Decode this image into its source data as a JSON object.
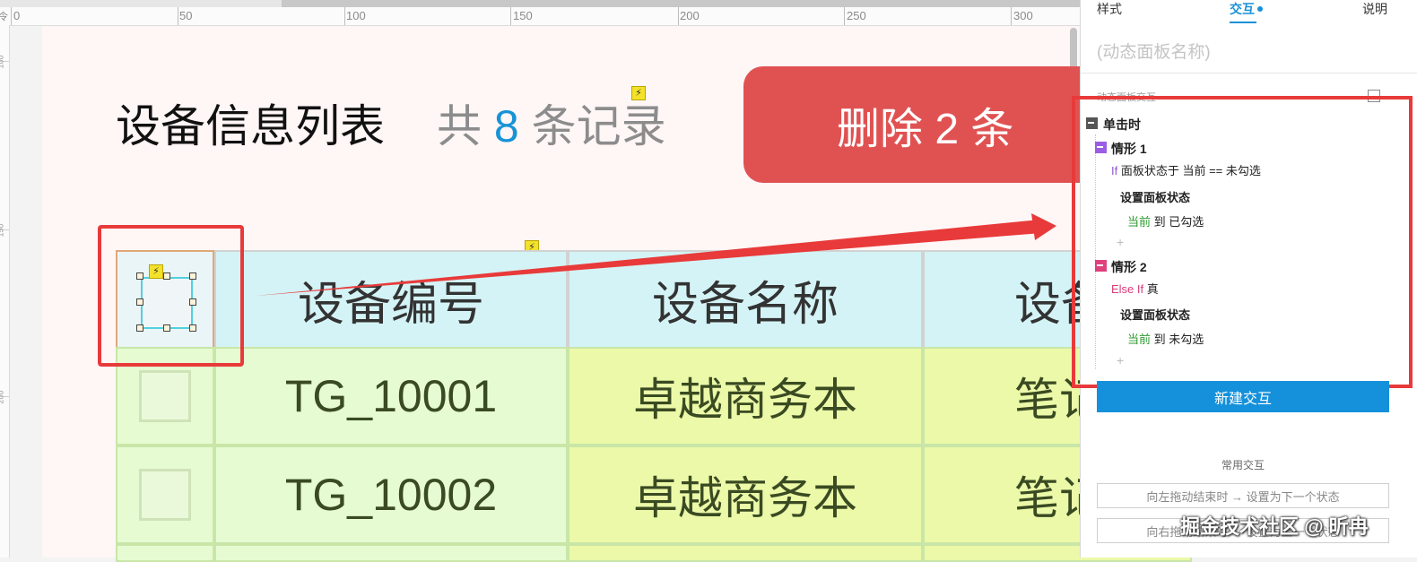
{
  "ruler": {
    "corner": "令",
    "labels": [
      "0",
      "50",
      "100",
      "150",
      "200",
      "250",
      "300"
    ],
    "vlabels": [
      "100",
      "150",
      "200"
    ]
  },
  "canvas": {
    "title": "设备信息列表",
    "count_prefix": "共",
    "count_value": "8",
    "count_suffix": "条记录",
    "delete_button": "删除 2 条",
    "headers": [
      "设备编号",
      "设备名称",
      "设备"
    ],
    "rows": [
      {
        "id": "TG_10001",
        "name": "卓越商务本",
        "type": "笔记"
      },
      {
        "id": "TG_10002",
        "name": "卓越商务本",
        "type": "笔记"
      }
    ]
  },
  "panel": {
    "tabs": [
      "样式",
      "交互",
      "说明"
    ],
    "name_placeholder": "(动态面板名称)",
    "section_label": "动态面板交互",
    "event": "单击时",
    "case1": {
      "title": "情形 1",
      "cond_kw": "If",
      "cond": "面板状态于 当前 == 未勾选",
      "action": "设置面板状态",
      "target": "当前",
      "to": "到 已勾选"
    },
    "case2": {
      "title": "情形 2",
      "cond_kw": "Else If",
      "cond": "真",
      "action": "设置面板状态",
      "target": "当前",
      "to": "到 未勾选"
    },
    "plus": "+",
    "new_button": "新建交互",
    "common_label": "常用交互",
    "options": [
      "向左拖动结束时 → 设置为下一个状态",
      "向右拖动结束时 → 设置为上一个状态"
    ]
  },
  "watermark": "掘金技术社区 @ 昕冉",
  "colors": {
    "accent": "#1591db",
    "delete": "#e05252",
    "highlight": "#e83a3a"
  }
}
